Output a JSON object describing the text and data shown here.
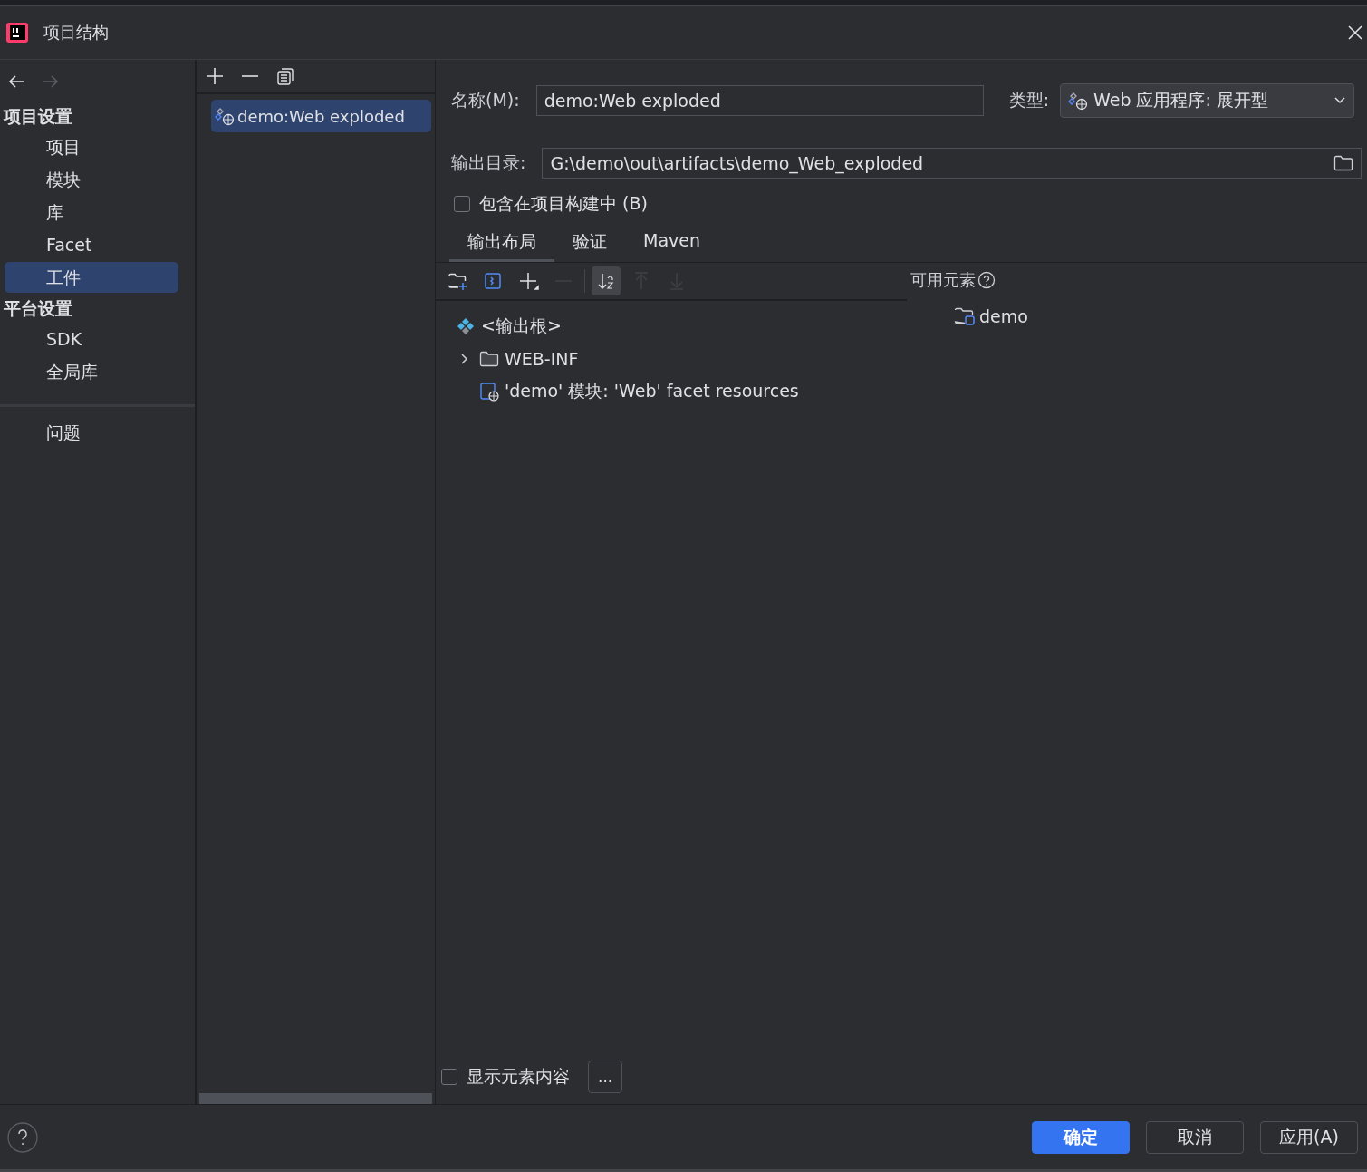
{
  "window": {
    "title": "项目结构"
  },
  "sidebar": {
    "nav": [
      {
        "kind": "back",
        "disabled": false
      },
      {
        "kind": "forward",
        "disabled": true
      }
    ],
    "sections": [
      {
        "title": "项目设置",
        "items": [
          {
            "label": "项目",
            "selected": false
          },
          {
            "label": "模块",
            "selected": false
          },
          {
            "label": "库",
            "selected": false
          },
          {
            "label": "Facet",
            "selected": false
          },
          {
            "label": "工件",
            "selected": true
          }
        ]
      },
      {
        "title": "平台设置",
        "items": [
          {
            "label": "SDK",
            "selected": false
          },
          {
            "label": "全局库",
            "selected": false
          }
        ]
      }
    ],
    "bottom_items": [
      {
        "label": "问题",
        "selected": false
      }
    ]
  },
  "artifacts": {
    "items": [
      {
        "label": "demo:Web exploded",
        "selected": true
      }
    ]
  },
  "form": {
    "name_label": "名称(M):",
    "name_value": "demo:Web exploded",
    "type_label": "类型:",
    "type_value": "Web 应用程序: 展开型",
    "output_label": "输出目录:",
    "output_value": "G:\\demo\\out\\artifacts\\demo_Web_exploded",
    "include_label": "包含在项目构建中 (B)",
    "include_checked": false
  },
  "tabs": [
    {
      "label": "输出布局",
      "selected": true
    },
    {
      "label": "验证",
      "selected": false
    },
    {
      "label": "Maven",
      "selected": false
    }
  ],
  "layout_tools": [
    {
      "kind": "new-folder",
      "disabled": false,
      "selected": false
    },
    {
      "kind": "module",
      "disabled": false,
      "selected": false
    },
    {
      "kind": "add",
      "disabled": false,
      "selected": false
    },
    {
      "kind": "remove",
      "disabled": true,
      "selected": false
    },
    {
      "kind": "sort",
      "disabled": false,
      "selected": true
    },
    {
      "kind": "up",
      "disabled": true,
      "selected": false
    },
    {
      "kind": "down",
      "disabled": true,
      "selected": false
    }
  ],
  "layout_tree": [
    {
      "kind": "root",
      "label": "<输出根>",
      "children": [
        {
          "kind": "folder",
          "label": "WEB-INF",
          "expanded": false
        },
        {
          "kind": "facet",
          "label": "'demo' 模块: 'Web' facet resources"
        }
      ]
    }
  ],
  "available": {
    "title": "可用元素",
    "items": [
      {
        "kind": "module-folder",
        "label": "demo"
      }
    ]
  },
  "show_content": {
    "label": "显示元素内容",
    "checked": false,
    "more": "..."
  },
  "buttons": [
    {
      "label": "确定",
      "kind": "primary"
    },
    {
      "label": "取消",
      "kind": "normal"
    },
    {
      "label": "应用(A)",
      "kind": "normal"
    }
  ]
}
